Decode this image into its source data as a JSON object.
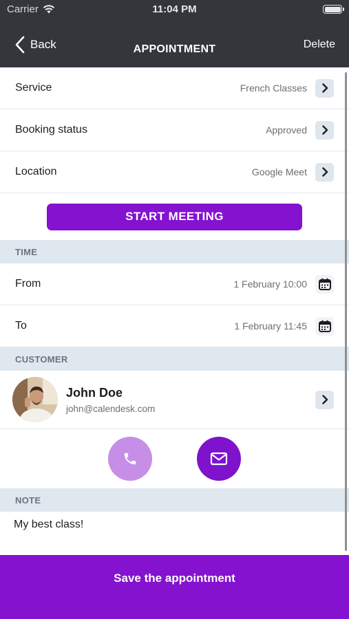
{
  "status_bar": {
    "carrier": "Carrier",
    "time": "11:04 PM"
  },
  "nav": {
    "back_label": "Back",
    "title": "APPOINTMENT",
    "delete_label": "Delete"
  },
  "details": [
    {
      "label": "Service",
      "value": "French Classes"
    },
    {
      "label": "Booking status",
      "value": "Approved"
    },
    {
      "label": "Location",
      "value": "Google Meet"
    }
  ],
  "start_meeting_label": "START MEETING",
  "time_section": {
    "title": "TIME",
    "from": {
      "label": "From",
      "value": "1 February 10:00"
    },
    "to": {
      "label": "To",
      "value": "1 February 11:45"
    }
  },
  "customer_section": {
    "title": "CUSTOMER",
    "name": "John Doe",
    "email": "john@calendesk.com"
  },
  "note_section": {
    "title": "NOTE",
    "text": "My best class!"
  },
  "save_label": "Save the appointment",
  "colors": {
    "accent": "#8412CF",
    "accent_light": "#C78EE8",
    "header": "#34363B",
    "section_bg": "#DFE7EF"
  },
  "icons": [
    "wifi-icon",
    "battery-icon",
    "back-chevron-icon",
    "chevron-right-icon",
    "calendar-icon",
    "phone-icon",
    "mail-icon"
  ]
}
